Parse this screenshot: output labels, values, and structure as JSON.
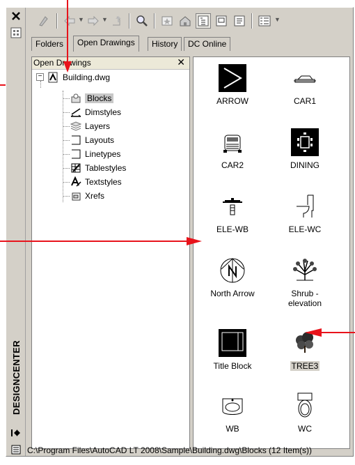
{
  "panel": {
    "title": "DESIGNCENTER"
  },
  "tabs": [
    {
      "label": "Folders",
      "active": false
    },
    {
      "label": "Open Drawings",
      "active": true
    },
    {
      "label": "History",
      "active": false
    },
    {
      "label": "DC Online",
      "active": false
    }
  ],
  "tree": {
    "header": "Open Drawings",
    "root": "Building.dwg",
    "children": [
      "Blocks",
      "Dimstyles",
      "Layers",
      "Layouts",
      "Linetypes",
      "Tablestyles",
      "Textstyles",
      "Xrefs"
    ],
    "selected": "Blocks"
  },
  "items": [
    {
      "label": "ARROW",
      "icon": "arrow-block-icon"
    },
    {
      "label": "CAR1",
      "icon": "car-side-icon"
    },
    {
      "label": "CAR2",
      "icon": "car-front-icon"
    },
    {
      "label": "DINING",
      "icon": "dining-table-icon"
    },
    {
      "label": "ELE-WB",
      "icon": "washbasin-elevation-icon"
    },
    {
      "label": "ELE-WC",
      "icon": "toilet-elevation-icon"
    },
    {
      "label": "North Arrow",
      "icon": "north-arrow-icon"
    },
    {
      "label": "Shrub -\nelevation",
      "icon": "shrub-icon"
    },
    {
      "label": "Title Block",
      "icon": "title-block-icon"
    },
    {
      "label": "TREE3",
      "icon": "tree-icon",
      "selected": true
    },
    {
      "label": "WB",
      "icon": "washbasin-icon"
    },
    {
      "label": "WC",
      "icon": "toilet-icon"
    }
  ],
  "status": {
    "path": "C:\\Program Files\\AutoCAD LT 2008\\Sample\\Building.dwg\\Blocks (12 Item(s))"
  },
  "colors": {
    "annotation_arrow": "#e8131b",
    "panel_bg": "#d4d0c8"
  }
}
